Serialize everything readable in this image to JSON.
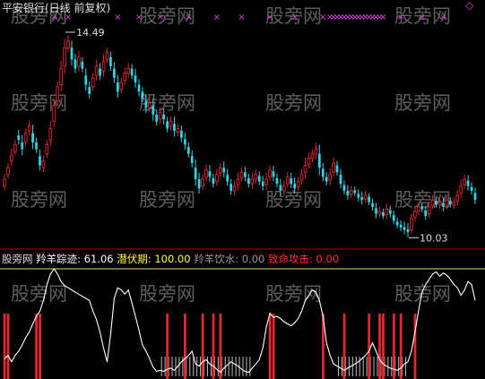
{
  "header": {
    "title": "平安银行(日线 前复权)",
    "wm_color": "#6e6e6e"
  },
  "watermark": {
    "text": "股旁网"
  },
  "colors": {
    "up": "#e3262f",
    "down": "#33d3e6",
    "marker": "#e040e0",
    "label": "#dddddd",
    "line": "#ffffff",
    "signal_red": "#e3262f",
    "ref_line": "#e8e07a",
    "divider": "#b00000"
  },
  "chart_data": [
    {
      "type": "candlestick",
      "title": "平安银行(日线 前复权)",
      "high_annotation": {
        "label": "14.49",
        "value": 14.49,
        "bar_index": 17
      },
      "low_annotation": {
        "label": "10.03",
        "value": 10.03,
        "bar_index": 114
      },
      "ylim": [
        9.9,
        14.8
      ],
      "grid": false,
      "close": [
        11.3,
        11.55,
        11.82,
        12.05,
        12.15,
        11.95,
        12.3,
        12.45,
        12.1,
        11.95,
        11.6,
        11.7,
        12.05,
        12.4,
        12.9,
        13.3,
        13.7,
        14.15,
        14.3,
        13.9,
        13.7,
        13.95,
        13.7,
        13.35,
        13.15,
        13.5,
        13.75,
        13.55,
        13.85,
        14.05,
        13.75,
        13.5,
        13.2,
        13.4,
        13.6,
        13.7,
        13.55,
        13.4,
        13.2,
        13.05,
        12.85,
        12.95,
        12.7,
        12.55,
        12.75,
        12.6,
        12.4,
        12.55,
        12.35,
        12.4,
        12.2,
        12.05,
        11.85,
        11.65,
        11.3,
        11.1,
        11.3,
        11.5,
        11.35,
        11.2,
        11.4,
        11.55,
        11.45,
        11.25,
        11.05,
        11.15,
        11.3,
        11.45,
        11.35,
        11.2,
        11.3,
        11.4,
        11.25,
        11.15,
        11.3,
        11.5,
        11.35,
        11.2,
        11.05,
        11.15,
        11.35,
        11.2,
        11.1,
        11.25,
        11.4,
        11.6,
        11.75,
        11.85,
        11.95,
        11.55,
        11.35,
        11.25,
        11.4,
        11.65,
        11.45,
        11.2,
        11.05,
        10.95,
        11.05,
        11.0,
        10.9,
        10.85,
        10.95,
        10.8,
        10.7,
        10.55,
        10.6,
        10.5,
        10.65,
        10.55,
        10.4,
        10.3,
        10.25,
        10.2,
        10.15,
        10.45,
        10.6,
        10.7,
        10.65,
        10.5,
        10.7,
        10.85,
        10.75,
        10.8,
        10.7,
        10.85,
        10.75,
        10.8,
        10.95,
        11.15,
        11.3,
        11.15,
        11.05,
        10.85
      ],
      "open_offsets": [
        -0.15,
        -0.15,
        -0.12,
        -0.15,
        0.1,
        0.15,
        -0.2,
        -0.1,
        0.2,
        0.15,
        0.2,
        -0.15,
        -0.2,
        -0.25,
        -0.35,
        -0.3,
        -0.35,
        -0.4,
        -0.15,
        0.25,
        0.2,
        -0.2,
        0.15,
        0.2,
        0.15,
        -0.2,
        -0.2,
        0.15,
        -0.2,
        -0.15,
        0.2,
        0.2,
        0.2,
        -0.15,
        -0.15,
        -0.1,
        0.15,
        0.15,
        0.15,
        0.15,
        0.15,
        -0.1,
        0.2,
        0.15,
        -0.15,
        0.1,
        0.15,
        -0.1,
        0.15,
        -0.08,
        0.15,
        0.12,
        0.15,
        0.15,
        0.25,
        0.2,
        -0.15,
        -0.15,
        0.12,
        0.12,
        -0.15,
        -0.12,
        0.1,
        0.15,
        0.15,
        -0.1,
        -0.12,
        -0.12,
        0.1,
        0.12,
        -0.1,
        -0.1,
        0.12,
        0.1,
        -0.12,
        -0.15,
        0.12,
        0.12,
        0.12,
        -0.1,
        -0.15,
        0.12,
        0.1,
        -0.12,
        -0.12,
        -0.15,
        -0.12,
        -0.1,
        -0.1,
        0.3,
        0.18,
        0.1,
        -0.12,
        -0.2,
        0.15,
        0.2,
        0.12,
        0.1,
        -0.08,
        0.06,
        0.08,
        0.06,
        -0.08,
        0.12,
        0.08,
        0.12,
        -0.06,
        0.08,
        -0.12,
        0.08,
        0.12,
        0.08,
        0.06,
        0.06,
        0.06,
        -0.25,
        -0.12,
        -0.1,
        0.06,
        0.12,
        -0.15,
        -0.12,
        0.08,
        -0.06,
        0.08,
        -0.12,
        0.08,
        -0.06,
        -0.12,
        -0.15,
        -0.12,
        0.12,
        0.08,
        0.15
      ],
      "shadow": [
        0.12,
        0.1,
        0.14,
        0.1,
        0.12,
        0.16,
        0.1,
        0.12,
        0.18,
        0.1,
        0.14,
        0.12,
        0.1,
        0.16,
        0.14,
        0.12,
        0.18,
        0.2,
        0.12,
        0.16,
        0.12,
        0.14,
        0.1,
        0.16,
        0.12,
        0.1,
        0.14,
        0.12,
        0.16,
        0.1,
        0.12,
        0.14,
        0.16,
        0.1,
        0.12,
        0.12,
        0.1,
        0.14,
        0.12,
        0.1,
        0.14,
        0.12,
        0.16,
        0.1,
        0.12,
        0.14,
        0.1,
        0.12,
        0.16,
        0.1,
        0.12,
        0.14,
        0.1,
        0.12,
        0.18,
        0.14,
        0.1,
        0.12,
        0.14,
        0.1,
        0.12,
        0.1,
        0.14,
        0.12,
        0.1,
        0.12,
        0.14,
        0.1,
        0.12,
        0.1,
        0.14,
        0.12,
        0.1,
        0.12,
        0.14,
        0.1,
        0.12,
        0.1,
        0.14,
        0.12,
        0.1,
        0.12,
        0.14,
        0.1,
        0.12,
        0.16,
        0.12,
        0.1,
        0.14,
        0.2,
        0.12,
        0.1,
        0.14,
        0.12,
        0.1,
        0.12,
        0.1,
        0.12,
        0.1,
        0.08,
        0.1,
        0.12,
        0.1,
        0.08,
        0.1,
        0.12,
        0.1,
        0.08,
        0.12,
        0.1,
        0.1,
        0.08,
        0.1,
        0.12,
        0.14,
        0.1,
        0.12,
        0.1,
        0.08,
        0.1,
        0.12,
        0.1,
        0.08,
        0.1,
        0.12,
        0.1,
        0.08,
        0.1,
        0.12,
        0.14,
        0.1,
        0.12,
        0.1,
        0.12
      ],
      "top_markers": {
        "glyph": "×",
        "bar_indices": [
          14,
          18,
          32,
          38,
          44,
          52,
          60,
          67,
          75,
          82,
          90,
          92,
          93,
          94,
          95,
          96,
          97,
          98,
          99,
          100,
          101,
          102,
          103,
          104,
          105,
          106,
          107,
          112,
          118,
          124
        ]
      },
      "corner_marker": {
        "glyph": "◇"
      }
    },
    {
      "type": "line",
      "indicator_name": "股旁网",
      "legend": [
        {
          "label": "羚羊踪迹",
          "value": "61.06",
          "color": "#ffffff"
        },
        {
          "label": "潜伏期",
          "value": "100.00",
          "color": "#ffff33"
        },
        {
          "label": "羚羊饮水",
          "value": "0.00",
          "color": "#9a9a9a"
        },
        {
          "label": "致命攻击",
          "value": "0.00",
          "color": "#ff3030"
        }
      ],
      "ylim": [
        0,
        100
      ],
      "reference_level": 100,
      "series": [
        {
          "values": [
            15,
            18,
            12,
            18,
            22,
            28,
            35,
            40,
            48,
            55,
            60,
            70,
            85,
            95,
            100,
            95,
            88,
            84,
            82,
            80,
            78,
            76,
            74,
            72,
            70,
            60,
            52,
            40,
            25,
            12,
            38,
            72,
            82,
            80,
            76,
            80,
            68,
            55,
            42,
            28,
            22,
            15,
            7,
            3,
            4,
            3,
            5,
            6,
            4,
            8,
            12,
            15,
            18,
            22,
            10,
            8,
            12,
            14,
            10,
            8,
            5,
            2,
            6,
            9,
            12,
            10,
            8,
            5,
            3,
            2,
            6,
            10,
            14,
            25,
            45,
            58,
            54,
            55,
            53,
            50,
            48,
            46,
            49,
            53,
            60,
            70,
            75,
            80,
            78,
            70,
            55,
            30,
            18,
            10,
            8,
            6,
            4,
            6,
            8,
            10,
            12,
            15,
            18,
            22,
            30,
            22,
            14,
            10,
            8,
            6,
            5,
            4,
            6,
            10,
            12,
            22,
            40,
            60,
            78,
            85,
            90,
            95,
            97,
            93,
            96,
            94,
            90,
            85,
            82,
            75,
            80,
            88,
            85,
            70
          ]
        }
      ],
      "red_bars": [
        0,
        1,
        9,
        10,
        46,
        51,
        56,
        59,
        61,
        75,
        76,
        90,
        96,
        103,
        106,
        107,
        110,
        112,
        116
      ],
      "gray_ticks": [
        44,
        45,
        46,
        47,
        48,
        49,
        50,
        51,
        52,
        53,
        54,
        55,
        56,
        57,
        58,
        59,
        60,
        61,
        62,
        63,
        64,
        65,
        66,
        67,
        68,
        69,
        94,
        95,
        96,
        97,
        98,
        99,
        100,
        101,
        102,
        103,
        104,
        105,
        106,
        107,
        108,
        109,
        110,
        111,
        112,
        113
      ]
    }
  ]
}
